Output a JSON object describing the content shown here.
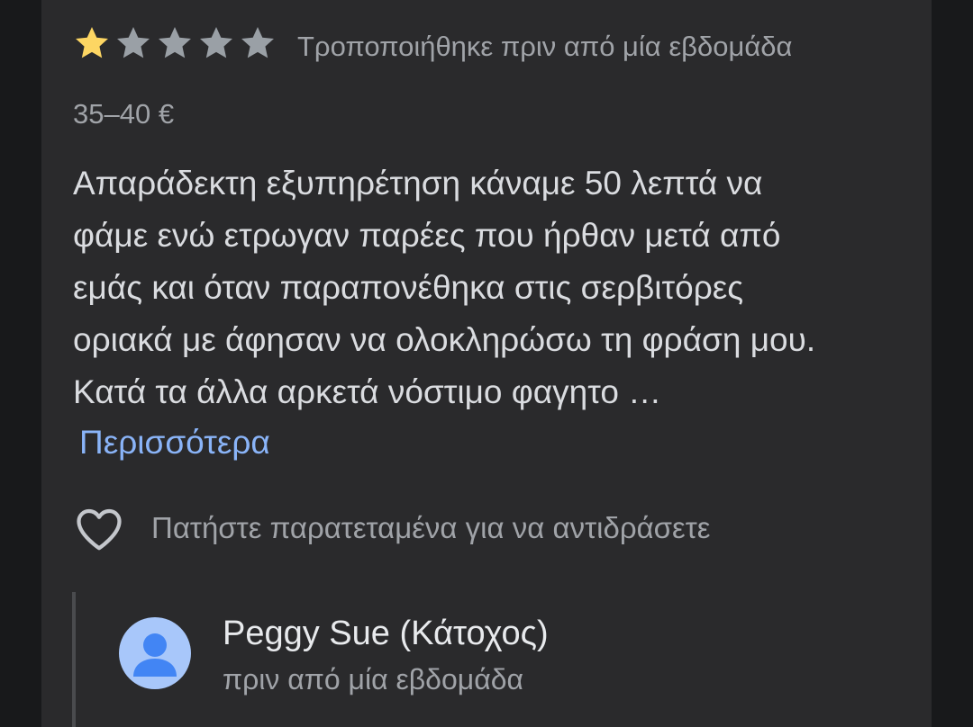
{
  "review": {
    "rating": 1,
    "max_rating": 5,
    "modified_text": "Τροποποιήθηκε πριν από μία εβδομάδα",
    "price_range": "35–40 €",
    "text_lines": [
      "Απαράδεκτη εξυπηρέτηση κάναμε 50 λεπτά να",
      "φάμε ενώ ετρωγαν παρέες που ήρθαν μετά από",
      "εμάς και όταν παραπονέθηκα στις σερβιτόρες",
      "οριακά με άφησαν να ολοκληρώσω τη φράση μου.",
      "Κατά τα άλλα αρκετά νόστιμο φαγητο …"
    ],
    "more_label": "Περισσότερα",
    "react_hint": "Πατήστε παρατεταμένα για να αντιδράσετε",
    "react_icon": "heart-outline-icon"
  },
  "owner_reply": {
    "name": "Peggy Sue (Κάτοχος)",
    "time": "πριν από μία εβδομάδα",
    "avatar_icon": "default-person-avatar"
  },
  "colors": {
    "background": "#18191b",
    "card": "#2a2a2c",
    "star_filled": "#fdd663",
    "star_empty": "#9aa0a6",
    "link": "#8ab4f8",
    "text_primary": "#dadce0",
    "text_secondary": "#a0a3a8",
    "avatar_bg": "#a8c7fa",
    "avatar_fg": "#4285f4"
  }
}
